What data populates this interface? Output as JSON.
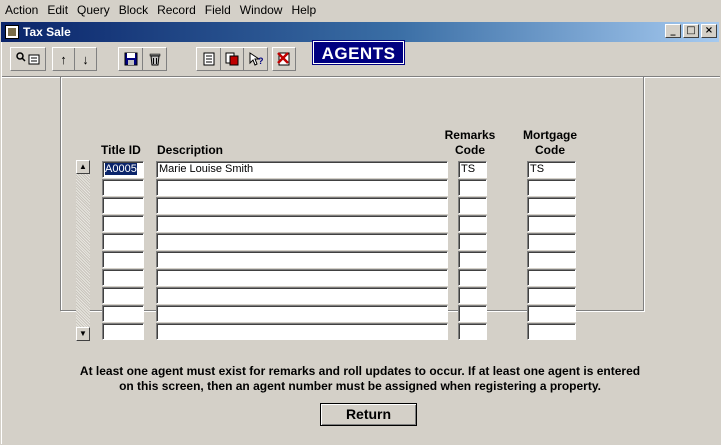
{
  "menu": [
    "Action",
    "Edit",
    "Query",
    "Block",
    "Record",
    "Field",
    "Window",
    "Help"
  ],
  "window": {
    "title": "Tax Sale",
    "minimize": "_",
    "maximize": "□",
    "close": "×"
  },
  "toolbar": {
    "icons": [
      "enter-query-icon",
      "arrow-up-icon",
      "arrow-down-icon",
      "save-icon",
      "delete-icon",
      "copy-icon",
      "clear-icon",
      "help-icon",
      "exit-icon"
    ],
    "up_arrow": "↑",
    "down_arrow": "↓"
  },
  "page": {
    "heading": "AGENTS"
  },
  "table": {
    "headers": {
      "title_id": "Title ID",
      "description": "Description",
      "remarks_1": "Remarks",
      "remarks_2": "Code",
      "mortgage_1": "Mortgage",
      "mortgage_2": "Code"
    },
    "rows": [
      {
        "title_id": "A0005",
        "description": "Marie Louise Smith",
        "remarks": "TS",
        "mortgage": "TS"
      },
      {
        "title_id": "",
        "description": "",
        "remarks": "",
        "mortgage": ""
      },
      {
        "title_id": "",
        "description": "",
        "remarks": "",
        "mortgage": ""
      },
      {
        "title_id": "",
        "description": "",
        "remarks": "",
        "mortgage": ""
      },
      {
        "title_id": "",
        "description": "",
        "remarks": "",
        "mortgage": ""
      },
      {
        "title_id": "",
        "description": "",
        "remarks": "",
        "mortgage": ""
      },
      {
        "title_id": "",
        "description": "",
        "remarks": "",
        "mortgage": ""
      },
      {
        "title_id": "",
        "description": "",
        "remarks": "",
        "mortgage": ""
      },
      {
        "title_id": "",
        "description": "",
        "remarks": "",
        "mortgage": ""
      },
      {
        "title_id": "",
        "description": "",
        "remarks": "",
        "mortgage": ""
      }
    ]
  },
  "info": {
    "line1": "At least one agent must exist for remarks and roll updates to occur.  If at least one agent is entered",
    "line2": "on this screen, then an agent number must be assigned when registering a property."
  },
  "buttons": {
    "return": "Return"
  }
}
